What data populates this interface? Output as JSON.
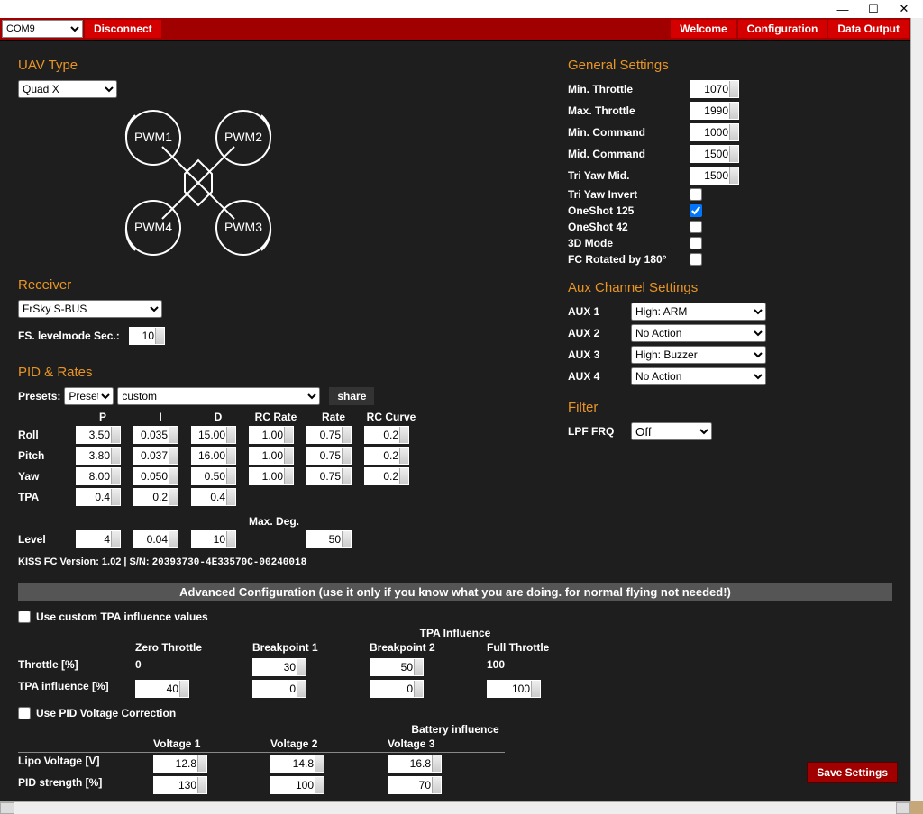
{
  "titlebar": {
    "minimize": "—",
    "maximize": "☐",
    "close": "✕"
  },
  "topbar": {
    "port": "COM9",
    "disconnect": "Disconnect",
    "welcome": "Welcome",
    "configuration": "Configuration",
    "data_output": "Data Output"
  },
  "sections": {
    "uav_type": "UAV Type",
    "receiver": "Receiver",
    "pid_rates": "PID & Rates",
    "general_settings": "General Settings",
    "aux_settings": "Aux Channel Settings",
    "filter": "Filter"
  },
  "uav": {
    "type": "Quad X",
    "motors": [
      "PWM1",
      "PWM2",
      "PWM3",
      "PWM4"
    ]
  },
  "receiver": {
    "type": "FrSky S-BUS",
    "fs_levelmode_label": "FS. levelmode Sec.:",
    "fs_levelmode_sec": "10"
  },
  "pid": {
    "presets_label": "Presets:",
    "preset_select": "Preset",
    "custom_select": "custom",
    "share": "share",
    "headers": [
      "",
      "P",
      "I",
      "D",
      "RC Rate",
      "Rate",
      "RC Curve"
    ],
    "rows": [
      {
        "label": "Roll",
        "P": "3.50",
        "I": "0.035",
        "D": "15.00",
        "RCRate": "1.00",
        "Rate": "0.75",
        "RCCurve": "0.2"
      },
      {
        "label": "Pitch",
        "P": "3.80",
        "I": "0.037",
        "D": "16.00",
        "RCRate": "1.00",
        "Rate": "0.75",
        "RCCurve": "0.2"
      },
      {
        "label": "Yaw",
        "P": "8.00",
        "I": "0.050",
        "D": "0.50",
        "RCRate": "1.00",
        "Rate": "0.75",
        "RCCurve": "0.2"
      },
      {
        "label": "TPA",
        "P": "0.4",
        "I": "0.2",
        "D": "0.4"
      }
    ],
    "max_deg_label": "Max. Deg.",
    "level": {
      "label": "Level",
      "P": "4",
      "I": "0.04",
      "D": "10",
      "max": "50"
    },
    "version": "KISS FC Version: 1.02 | S/N:",
    "sn": "20393730-4E33570C-00240018"
  },
  "general": {
    "rows": [
      {
        "label": "Min. Throttle",
        "value": "1070"
      },
      {
        "label": "Max. Throttle",
        "value": "1990"
      },
      {
        "label": "Min. Command",
        "value": "1000"
      },
      {
        "label": "Mid. Command",
        "value": "1500"
      },
      {
        "label": "Tri Yaw Mid.",
        "value": "1500"
      }
    ],
    "checks": [
      {
        "label": "Tri Yaw Invert",
        "checked": false
      },
      {
        "label": "OneShot 125",
        "checked": true
      },
      {
        "label": "OneShot 42",
        "checked": false
      },
      {
        "label": "3D Mode",
        "checked": false
      },
      {
        "label": "FC Rotated by 180°",
        "checked": false
      }
    ]
  },
  "aux": {
    "items": [
      {
        "label": "AUX 1",
        "value": "High: ARM"
      },
      {
        "label": "AUX 2",
        "value": "No Action"
      },
      {
        "label": "AUX 3",
        "value": "High: Buzzer"
      },
      {
        "label": "AUX 4",
        "value": "No Action"
      }
    ]
  },
  "filter": {
    "lpf_label": "LPF FRQ",
    "lpf_value": "Off"
  },
  "advanced": {
    "banner": "Advanced Configuration (use it only if you know what you are doing. for normal flying not needed!)",
    "use_custom_tpa": "Use custom TPA influence values",
    "tpa_title": "TPA Influence",
    "tpa_headers": [
      "",
      "Zero Throttle",
      "Breakpoint 1",
      "Breakpoint 2",
      "Full Throttle"
    ],
    "throttle_label": "Throttle [%]",
    "throttle_vals": [
      "0",
      "30",
      "50",
      "100"
    ],
    "tpa_inf_label": "TPA influence [%]",
    "tpa_inf_vals": [
      "40",
      "0",
      "0",
      "100"
    ],
    "use_pid_voltage": "Use PID Voltage Correction",
    "batt_title": "Battery influence",
    "batt_headers": [
      "",
      "Voltage 1",
      "Voltage 2",
      "Voltage 3"
    ],
    "lipo_label": "Lipo Voltage [V]",
    "lipo_vals": [
      "12.8",
      "14.8",
      "16.8"
    ],
    "pid_str_label": "PID strength [%]",
    "pid_str_vals": [
      "130",
      "100",
      "70"
    ]
  },
  "save": "Save Settings"
}
